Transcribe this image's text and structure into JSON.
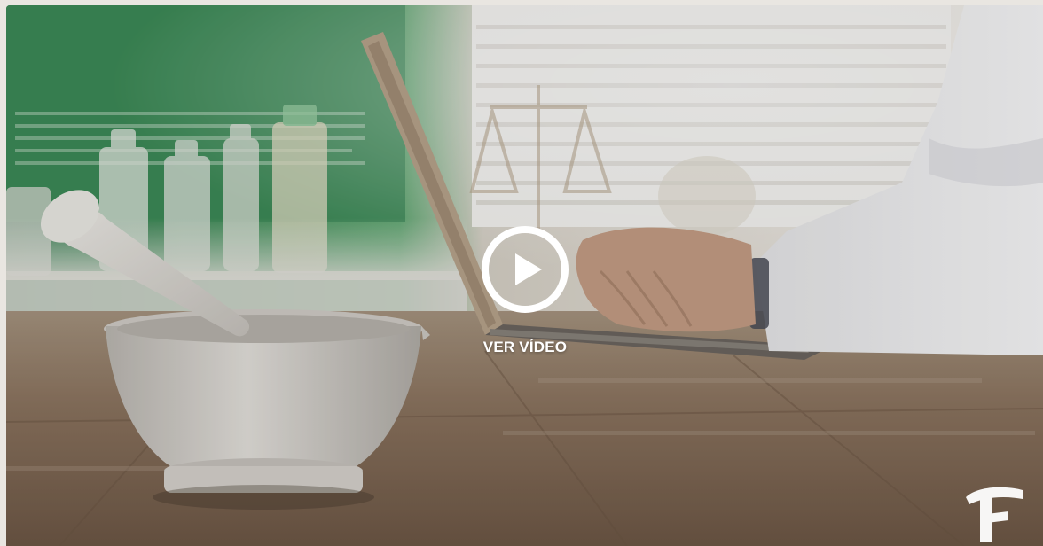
{
  "video": {
    "play_label": "VER VÍDEO",
    "play_icon": "play-circle-icon",
    "brand_logo_icon": "pharmacy-f-logo-icon"
  },
  "colors": {
    "overlay_text": "#ffffff",
    "wall_green": "#3f8f5a",
    "table_wood": "#8a6f55",
    "mortar": "#d9d6d1"
  }
}
